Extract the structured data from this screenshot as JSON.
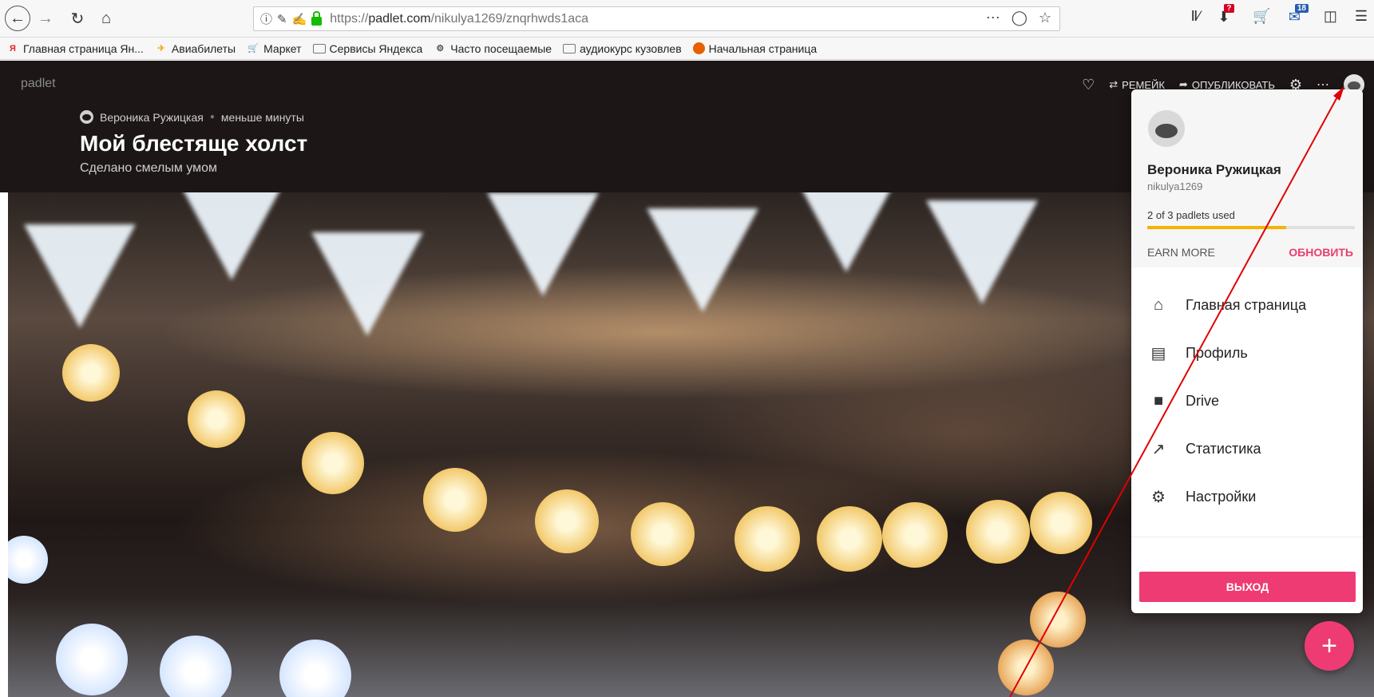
{
  "browser": {
    "url_prefix": "https://",
    "url_host": "padlet.com",
    "url_path": "/nikulya1269/znqrhwds1aca",
    "url_menu_icon": "more-horizontal-icon",
    "pocket_icon": "pocket-icon",
    "bookmark_icon": "star-icon",
    "addon_badge_1": "?",
    "addon_badge_2": "18"
  },
  "bookmarks": [
    {
      "label": "Главная страница Ян...",
      "icon": "yandex-icon",
      "color": "#e52620"
    },
    {
      "label": "Авиабилеты",
      "icon": "plane-icon",
      "color": "#f5a623"
    },
    {
      "label": "Маркет",
      "icon": "cart-icon",
      "color": "#2f80ed"
    },
    {
      "label": "Сервисы Яндекса",
      "icon": "folder-icon",
      "color": "#777777"
    },
    {
      "label": "Часто посещаемые",
      "icon": "gear-icon",
      "color": "#555555"
    },
    {
      "label": "аудиокурс кузовлев",
      "icon": "folder-icon",
      "color": "#777777"
    },
    {
      "label": "Начальная страница",
      "icon": "firefox-icon",
      "color": "#e66000"
    }
  ],
  "padlet": {
    "brand": "padlet",
    "author": "Вероника Ружицкая",
    "time": "меньше минуты",
    "title": "Мой блестяще холст",
    "subtitle": "Сделано смелым умом",
    "actions": {
      "remake": "РЕМЕЙК",
      "publish": "ОПУБЛИКОВАТЬ"
    }
  },
  "dropdown": {
    "name": "Вероника Ружицкая",
    "username": "nikulya1269",
    "usage_text": "2 of 3 padlets used",
    "usage_fraction": 0.67,
    "earn_more": "EARN MORE",
    "upgrade": "ОБНОВИТЬ",
    "menu": [
      {
        "label": "Главная страница",
        "icon": "home-icon"
      },
      {
        "label": "Профиль",
        "icon": "profile-icon"
      },
      {
        "label": "Drive",
        "icon": "folder-icon"
      },
      {
        "label": "Статистика",
        "icon": "chart-icon"
      },
      {
        "label": "Настройки",
        "icon": "gear-icon"
      }
    ],
    "logout": "ВЫХОД"
  },
  "fab": {
    "label": "+"
  },
  "colors": {
    "accent": "#ee3b73",
    "header_bg": "#1c1616",
    "usage_bar": "#f4b400",
    "annotation": "#e00000"
  }
}
